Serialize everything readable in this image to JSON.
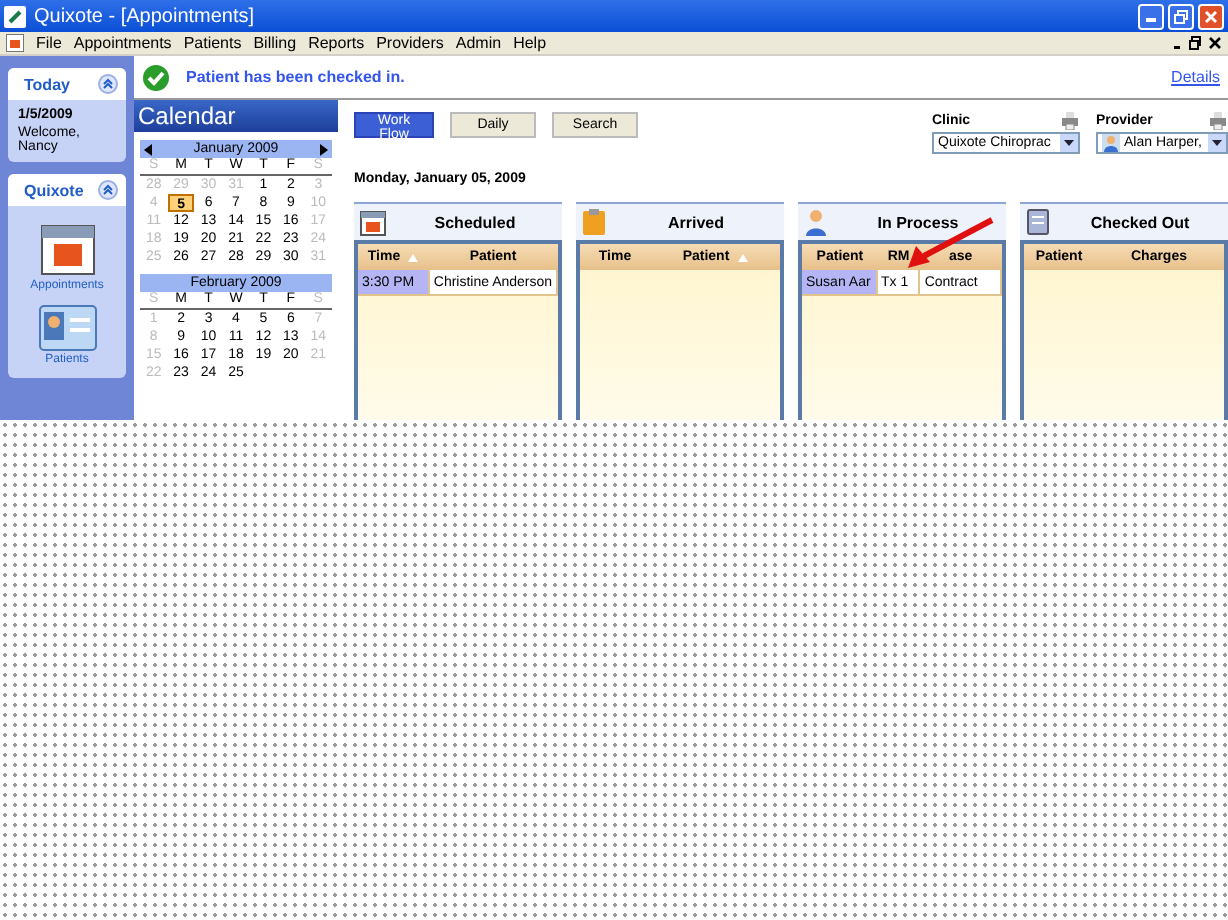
{
  "window": {
    "title": "Quixote - [Appointments]"
  },
  "menu": {
    "items": [
      "File",
      "Appointments",
      "Patients",
      "Billing",
      "Reports",
      "Providers",
      "Admin",
      "Help"
    ]
  },
  "sidebar": {
    "today": {
      "title": "Today",
      "date": "1/5/2009",
      "greeting": "Welcome, Nancy"
    },
    "apps": {
      "title": "Quixote",
      "items": [
        {
          "label": "Appointments",
          "kind": "calendar"
        },
        {
          "label": "Patients",
          "kind": "card"
        }
      ]
    }
  },
  "notice": {
    "text": "Patient has been checked in.",
    "link": "Details"
  },
  "calendar": {
    "title": "Calendar",
    "months": [
      {
        "name": "January 2009",
        "nav": true,
        "weekdays": [
          "S",
          "M",
          "T",
          "W",
          "T",
          "F",
          "S"
        ],
        "weeks": [
          [
            {
              "d": "28",
              "muted": true,
              "selected": false
            },
            {
              "d": "29",
              "muted": true,
              "selected": false
            },
            {
              "d": "30",
              "muted": true,
              "selected": false
            },
            {
              "d": "31",
              "muted": true,
              "selected": false
            },
            {
              "d": "1",
              "muted": false,
              "selected": false
            },
            {
              "d": "2",
              "muted": false,
              "selected": false
            },
            {
              "d": "3",
              "muted": true,
              "selected": false
            }
          ],
          [
            {
              "d": "4",
              "muted": true,
              "selected": false
            },
            {
              "d": "5",
              "muted": false,
              "selected": true
            },
            {
              "d": "6",
              "muted": false,
              "selected": false
            },
            {
              "d": "7",
              "muted": false,
              "selected": false
            },
            {
              "d": "8",
              "muted": false,
              "selected": false
            },
            {
              "d": "9",
              "muted": false,
              "selected": false
            },
            {
              "d": "10",
              "muted": true,
              "selected": false
            }
          ],
          [
            {
              "d": "11",
              "muted": true,
              "selected": false
            },
            {
              "d": "12",
              "muted": false,
              "selected": false
            },
            {
              "d": "13",
              "muted": false,
              "selected": false
            },
            {
              "d": "14",
              "muted": false,
              "selected": false
            },
            {
              "d": "15",
              "muted": false,
              "selected": false
            },
            {
              "d": "16",
              "muted": false,
              "selected": false
            },
            {
              "d": "17",
              "muted": true,
              "selected": false
            }
          ],
          [
            {
              "d": "18",
              "muted": true,
              "selected": false
            },
            {
              "d": "19",
              "muted": false,
              "selected": false
            },
            {
              "d": "20",
              "muted": false,
              "selected": false
            },
            {
              "d": "21",
              "muted": false,
              "selected": false
            },
            {
              "d": "22",
              "muted": false,
              "selected": false
            },
            {
              "d": "23",
              "muted": false,
              "selected": false
            },
            {
              "d": "24",
              "muted": true,
              "selected": false
            }
          ],
          [
            {
              "d": "25",
              "muted": true,
              "selected": false
            },
            {
              "d": "26",
              "muted": false,
              "selected": false
            },
            {
              "d": "27",
              "muted": false,
              "selected": false
            },
            {
              "d": "28",
              "muted": false,
              "selected": false
            },
            {
              "d": "29",
              "muted": false,
              "selected": false
            },
            {
              "d": "30",
              "muted": false,
              "selected": false
            },
            {
              "d": "31",
              "muted": true,
              "selected": false
            }
          ]
        ]
      },
      {
        "name": "February 2009",
        "nav": false,
        "weekdays": [
          "S",
          "M",
          "T",
          "W",
          "T",
          "F",
          "S"
        ],
        "weeks": [
          [
            {
              "d": "1",
              "muted": true,
              "selected": false
            },
            {
              "d": "2",
              "muted": false,
              "selected": false
            },
            {
              "d": "3",
              "muted": false,
              "selected": false
            },
            {
              "d": "4",
              "muted": false,
              "selected": false
            },
            {
              "d": "5",
              "muted": false,
              "selected": false
            },
            {
              "d": "6",
              "muted": false,
              "selected": false
            },
            {
              "d": "7",
              "muted": true,
              "selected": false
            }
          ],
          [
            {
              "d": "8",
              "muted": true,
              "selected": false
            },
            {
              "d": "9",
              "muted": false,
              "selected": false
            },
            {
              "d": "10",
              "muted": false,
              "selected": false
            },
            {
              "d": "11",
              "muted": false,
              "selected": false
            },
            {
              "d": "12",
              "muted": false,
              "selected": false
            },
            {
              "d": "13",
              "muted": false,
              "selected": false
            },
            {
              "d": "14",
              "muted": true,
              "selected": false
            }
          ],
          [
            {
              "d": "15",
              "muted": true,
              "selected": false
            },
            {
              "d": "16",
              "muted": false,
              "selected": false
            },
            {
              "d": "17",
              "muted": false,
              "selected": false
            },
            {
              "d": "18",
              "muted": false,
              "selected": false
            },
            {
              "d": "19",
              "muted": false,
              "selected": false
            },
            {
              "d": "20",
              "muted": false,
              "selected": false
            },
            {
              "d": "21",
              "muted": true,
              "selected": false
            }
          ],
          [
            {
              "d": "22",
              "muted": true,
              "selected": false
            },
            {
              "d": "23",
              "muted": false,
              "selected": false
            },
            {
              "d": "24",
              "muted": false,
              "selected": false
            },
            {
              "d": "25",
              "muted": false,
              "selected": false
            }
          ]
        ]
      }
    ]
  },
  "toolbar": {
    "buttons": [
      {
        "label": "Work Flow",
        "selected": true
      },
      {
        "label": "Daily",
        "selected": false
      },
      {
        "label": "Search",
        "selected": false
      }
    ]
  },
  "clinic": {
    "label": "Clinic",
    "value": "Quixote Chiroprac"
  },
  "provider": {
    "label": "Provider",
    "value": "Alan Harper,"
  },
  "date": "Monday, January 05, 2009",
  "lanes": [
    {
      "title": "Scheduled",
      "kind": "calendar",
      "columns": [
        {
          "label": "Time",
          "sorted": true
        },
        {
          "label": "Patient",
          "sorted": false
        }
      ],
      "rows": [
        [
          {
            "text": "3:30 PM",
            "highlight": true
          },
          {
            "text": "Christine Anderson",
            "highlight": false
          }
        ]
      ]
    },
    {
      "title": "Arrived",
      "kind": "clipboard",
      "columns": [
        {
          "label": "Time",
          "sorted": false
        },
        {
          "label": "Patient",
          "sorted": true
        }
      ]
    },
    {
      "title": "In Process",
      "kind": "person",
      "columns": [
        {
          "label": "Patient",
          "sorted": false
        },
        {
          "label": "RM",
          "sorted": false
        },
        {
          "label": "ase",
          "sorted": false
        }
      ],
      "rows": [
        [
          {
            "text": "Susan Aar",
            "highlight": true
          },
          {
            "text": "Tx 1",
            "highlight": false
          },
          {
            "text": "Contract",
            "highlight": false
          }
        ]
      ]
    },
    {
      "title": "Checked Out",
      "kind": "receipt",
      "columns": [
        {
          "label": "Patient",
          "sorted": false
        },
        {
          "label": "Charges",
          "sorted": false
        }
      ]
    }
  ]
}
